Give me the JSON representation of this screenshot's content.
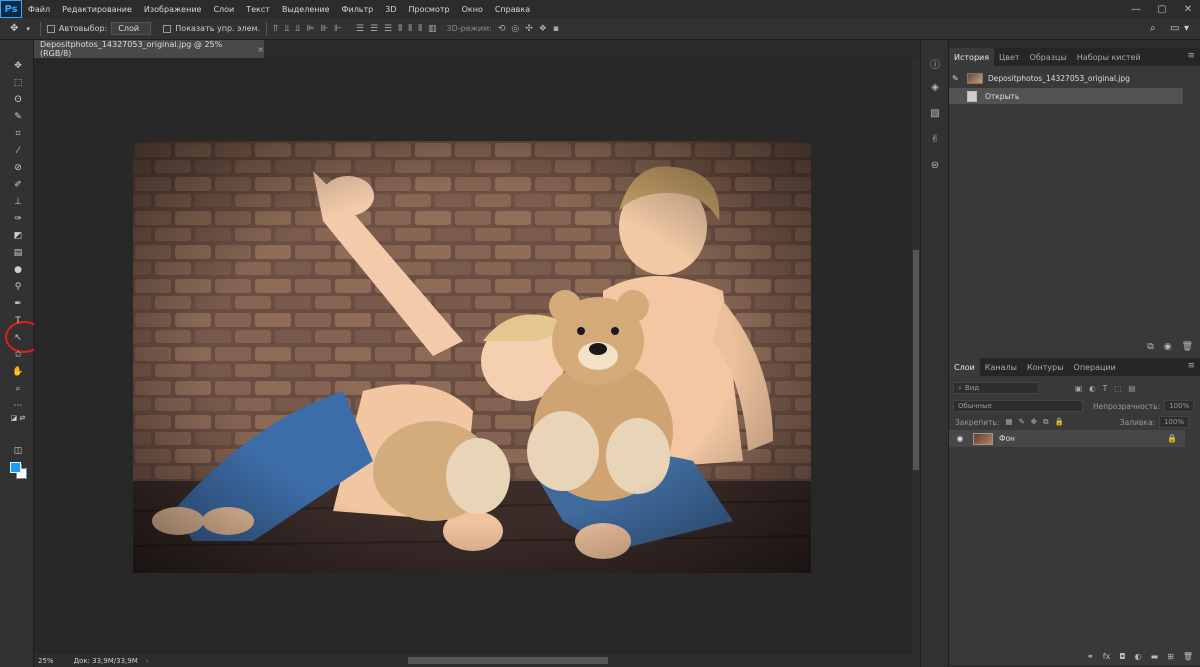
{
  "app": {
    "logo": "Ps"
  },
  "menu": [
    "Файл",
    "Редактирование",
    "Изображение",
    "Слои",
    "Текст",
    "Выделение",
    "Фильтр",
    "3D",
    "Просмотр",
    "Окно",
    "Справка"
  ],
  "options": {
    "autoselect_label": "Автовыбор:",
    "autoselect_value": "Слой",
    "show_transform_label": "Показать упр. элем.",
    "mode3d_label": "3D-режим:"
  },
  "document": {
    "tab_title": "Depositphotos_14327053_original.jpg @ 25% (RGB/8)",
    "tab_close": "×",
    "zoom": "25%",
    "doc_info": "Док: 33,9M/33,9M"
  },
  "history_panel": {
    "tabs": [
      "История",
      "Цвет",
      "Образцы",
      "Наборы кистей"
    ],
    "source": "Depositphotos_14327053_original.jpg",
    "steps": [
      "Открыть"
    ]
  },
  "layers_panel": {
    "tabs": [
      "Слои",
      "Каналы",
      "Контуры",
      "Операции"
    ],
    "search_placeholder": "Вид",
    "blend_mode": "Обычные",
    "opacity_label": "Непрозрачность:",
    "opacity_value": "100%",
    "lock_label": "Закрепить:",
    "fill_label": "Заливка:",
    "fill_value": "100%",
    "layers": [
      {
        "name": "Фон",
        "visible": true,
        "locked": true
      }
    ]
  },
  "colors": {
    "foreground": "#1a9cff",
    "background": "#ffffff",
    "annotation_circle": "#e02020"
  }
}
